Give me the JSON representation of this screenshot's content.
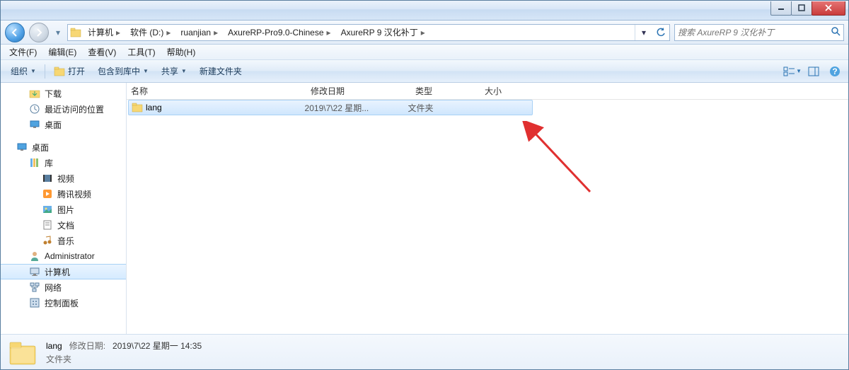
{
  "window_controls": {
    "min": "—",
    "max": "☐",
    "close": "✕"
  },
  "breadcrumbs": [
    "计算机",
    "软件 (D:)",
    "ruanjian",
    "AxureRP-Pro9.0-Chinese",
    "AxureRP 9 汉化补丁"
  ],
  "search": {
    "placeholder": "搜索 AxureRP 9 汉化补丁"
  },
  "menubar": [
    "文件(F)",
    "编辑(E)",
    "查看(V)",
    "工具(T)",
    "帮助(H)"
  ],
  "toolbar": {
    "organize": "组织",
    "open": "打开",
    "include": "包含到库中",
    "share": "共享",
    "new_folder": "新建文件夹"
  },
  "sidebar": {
    "quick": [
      {
        "label": "下载",
        "icon": "download"
      },
      {
        "label": "最近访问的位置",
        "icon": "recent"
      },
      {
        "label": "桌面",
        "icon": "desktop"
      }
    ],
    "desktop_root": "桌面",
    "tree": [
      {
        "label": "库",
        "icon": "library",
        "children": [
          {
            "label": "视频",
            "icon": "video"
          },
          {
            "label": "腾讯视频",
            "icon": "tvideo"
          },
          {
            "label": "图片",
            "icon": "pictures"
          },
          {
            "label": "文档",
            "icon": "docs"
          },
          {
            "label": "音乐",
            "icon": "music"
          }
        ]
      },
      {
        "label": "Administrator",
        "icon": "user"
      },
      {
        "label": "计算机",
        "icon": "computer",
        "selected": true
      },
      {
        "label": "网络",
        "icon": "network"
      },
      {
        "label": "控制面板",
        "icon": "cpanel"
      }
    ]
  },
  "columns": {
    "name": "名称",
    "date": "修改日期",
    "type": "类型",
    "size": "大小"
  },
  "rows": [
    {
      "name": "lang",
      "date": "2019\\7\\22 星期...",
      "type": "文件夹",
      "size": "",
      "selected": true
    }
  ],
  "status": {
    "name": "lang",
    "date_label": "修改日期:",
    "date": "2019\\7\\22 星期一 14:35",
    "type": "文件夹"
  }
}
